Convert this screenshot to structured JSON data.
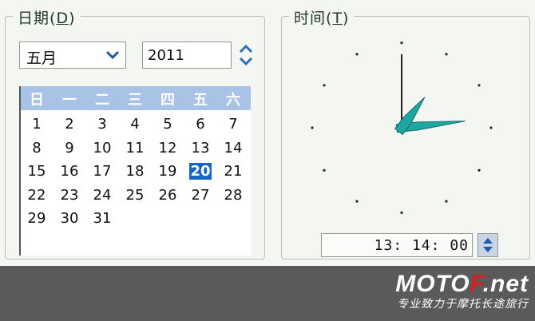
{
  "date_group": {
    "title": "日期",
    "mnemonic": "D"
  },
  "time_group": {
    "title": "时间",
    "mnemonic": "T"
  },
  "month_select": {
    "value": "五月"
  },
  "year_field": {
    "value": "2011"
  },
  "calendar": {
    "weekdays": [
      "日",
      "一",
      "二",
      "三",
      "四",
      "五",
      "六"
    ],
    "weeks": [
      [
        "1",
        "2",
        "3",
        "4",
        "5",
        "6",
        "7"
      ],
      [
        "8",
        "9",
        "10",
        "11",
        "12",
        "13",
        "14"
      ],
      [
        "15",
        "16",
        "17",
        "18",
        "19",
        "20",
        "21"
      ],
      [
        "22",
        "23",
        "24",
        "25",
        "26",
        "27",
        "28"
      ],
      [
        "29",
        "30",
        "31",
        "",
        "",
        "",
        ""
      ]
    ],
    "selected_day": "20"
  },
  "clock": {
    "hour": 13,
    "minute": 14,
    "second": 0,
    "hand_color": "#1ea7a0"
  },
  "time_field": {
    "value": "13: 14: 00"
  },
  "watermark": {
    "logo_main": "MOTO",
    "logo_accent": "F",
    "logo_suffix": ".net",
    "tagline": "专业致力于摩托长途旅行"
  },
  "colors": {
    "accent_selected": "#1666c8",
    "calendar_header": "#a8c3e6"
  }
}
